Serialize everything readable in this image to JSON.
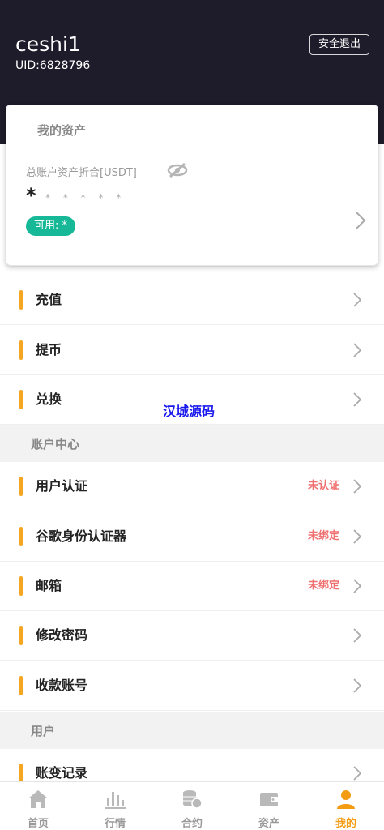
{
  "header": {
    "username": "ceshi1",
    "uid": "UID:6828796",
    "logout_label": "安全退出"
  },
  "assets_card": {
    "title": "我的资产",
    "total_label": "总账户资产折合[USDT]",
    "total_value": "*",
    "hidden_value": "* * * * *",
    "available_label": "可用: *"
  },
  "menu_top": [
    {
      "label": "充值"
    },
    {
      "label": "提币"
    },
    {
      "label": "兑换"
    }
  ],
  "watermark": "汉城源码",
  "section_account": {
    "title": "账户中心",
    "items": [
      {
        "label": "用户认证",
        "status": "未认证"
      },
      {
        "label": "谷歌身份认证器",
        "status": "未绑定"
      },
      {
        "label": "邮箱",
        "status": "未绑定"
      },
      {
        "label": "修改密码",
        "status": ""
      },
      {
        "label": "收款账号",
        "status": ""
      }
    ]
  },
  "section_user": {
    "title": "用户",
    "items": [
      {
        "label": "账变记录"
      }
    ]
  },
  "tabbar": [
    {
      "label": "首页",
      "icon": "home-icon",
      "active": false
    },
    {
      "label": "行情",
      "icon": "bar-chart-icon",
      "active": false
    },
    {
      "label": "合约",
      "icon": "coins-icon",
      "active": false
    },
    {
      "label": "资产",
      "icon": "wallet-icon",
      "active": false
    },
    {
      "label": "我的",
      "icon": "user-icon",
      "active": true
    }
  ],
  "colors": {
    "header_bg": "#1e1b2a",
    "accent_bar": "#f5a623",
    "available_badge": "#17b897",
    "status_red": "#f07070",
    "active_tab": "#f39c12",
    "watermark": "#1a1aee"
  }
}
